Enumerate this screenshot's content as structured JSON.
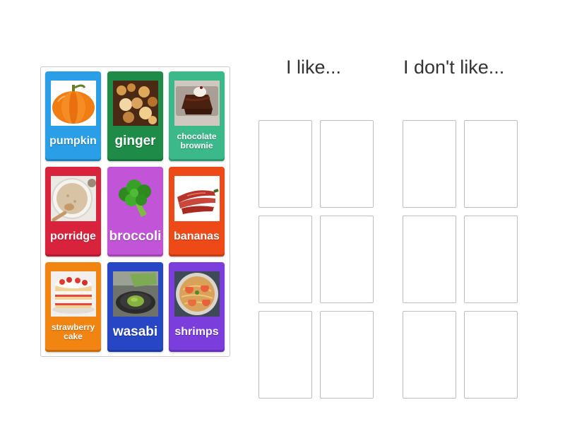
{
  "headings": {
    "like": "I like...",
    "dislike": "I don't like..."
  },
  "cards": [
    {
      "label": "pumpkin",
      "color": "#2a9ee6",
      "icon": "pumpkin-icon"
    },
    {
      "label": "ginger",
      "color": "#1f8b48",
      "icon": "ginger-icon"
    },
    {
      "label": "chocolate brownie",
      "color": "#3cb98a",
      "icon": "brownie-icon"
    },
    {
      "label": "porridge",
      "color": "#d9233d",
      "icon": "porridge-icon"
    },
    {
      "label": "broccoli",
      "color": "#c254d8",
      "icon": "broccoli-icon"
    },
    {
      "label": "bananas",
      "color": "#ee4a18",
      "icon": "bananas-icon"
    },
    {
      "label": "strawberry cake",
      "color": "#f28411",
      "icon": "cake-icon"
    },
    {
      "label": "wasabi",
      "color": "#2646c6",
      "icon": "wasabi-icon"
    },
    {
      "label": "shrimps",
      "color": "#7b3ddc",
      "icon": "shrimps-icon"
    }
  ]
}
